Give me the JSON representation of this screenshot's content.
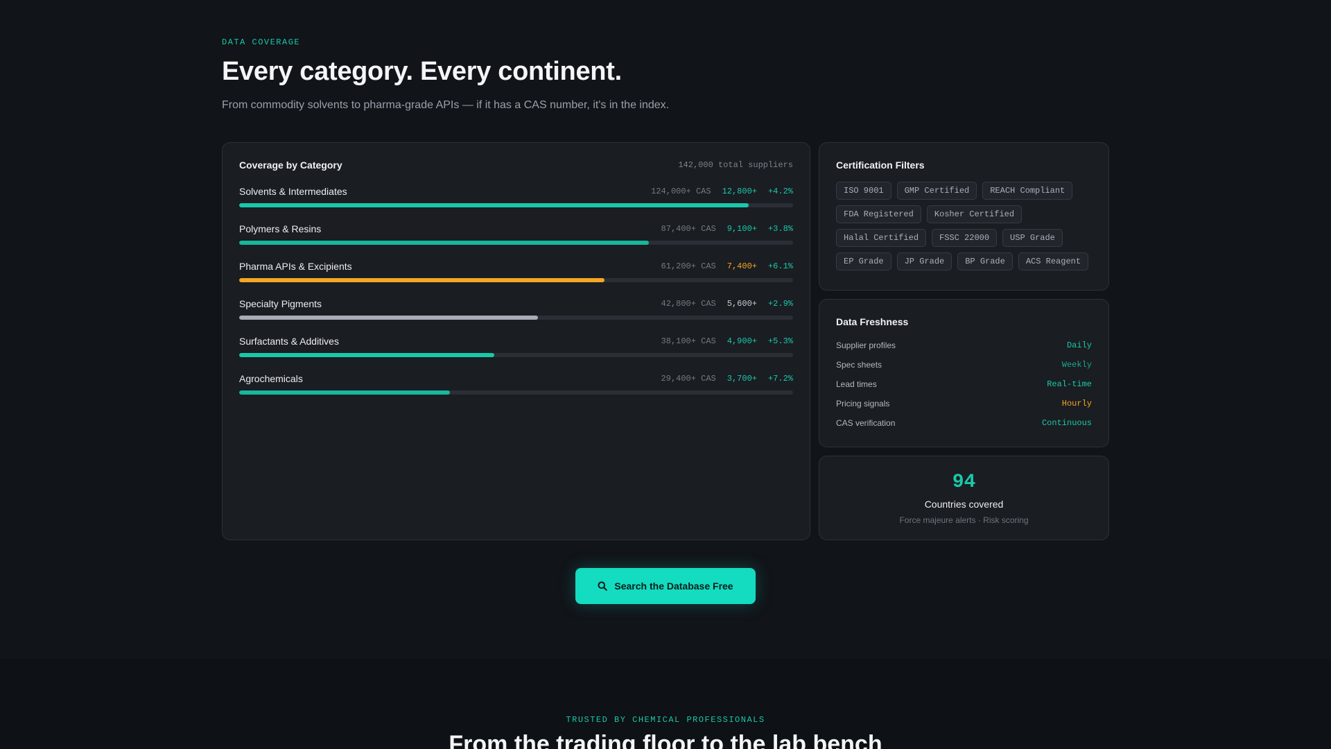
{
  "hero": {
    "eyebrow": "DATA COVERAGE",
    "title": "Every category. Every continent.",
    "subtitle": "From commodity solvents to pharma-grade APIs — if it has a CAS number, it's in the index."
  },
  "coverage": {
    "title": "Coverage by Category",
    "total": "142,000 total suppliers",
    "categories": [
      {
        "name": "Solvents & Intermediates",
        "cas": "124,000+ CAS",
        "count": "12,800+",
        "growth": "+4.2%",
        "fill": 0.92,
        "color": "#19c9aa",
        "count_color": "#19c9aa"
      },
      {
        "name": "Polymers & Resins",
        "cas": "87,400+ CAS",
        "count": "9,100+",
        "growth": "+3.8%",
        "fill": 0.74,
        "color": "#17b89c",
        "count_color": "#19c9aa"
      },
      {
        "name": "Pharma APIs & Excipients",
        "cas": "61,200+ CAS",
        "count": "7,400+",
        "growth": "+6.1%",
        "fill": 0.66,
        "color": "#f5a623",
        "count_color": "#f5a623"
      },
      {
        "name": "Specialty Pigments",
        "cas": "42,800+ CAS",
        "count": "5,600+",
        "growth": "+2.9%",
        "fill": 0.54,
        "color": "#a9acb6",
        "count_color": "#c9cdd3"
      },
      {
        "name": "Surfactants & Additives",
        "cas": "38,100+ CAS",
        "count": "4,900+",
        "growth": "+5.3%",
        "fill": 0.46,
        "color": "#19c9aa",
        "count_color": "#19c9aa"
      },
      {
        "name": "Agrochemicals",
        "cas": "29,400+ CAS",
        "count": "3,700+",
        "growth": "+7.2%",
        "fill": 0.38,
        "color": "#17b89c",
        "count_color": "#19c9aa"
      }
    ]
  },
  "certs": {
    "title": "Certification Filters",
    "tags": [
      "ISO 9001",
      "GMP Certified",
      "REACH Compliant",
      "FDA Registered",
      "Kosher Certified",
      "Halal Certified",
      "FSSC 22000",
      "USP Grade",
      "EP Grade",
      "JP Grade",
      "BP Grade",
      "ACS Reagent"
    ]
  },
  "freshness": {
    "title": "Data Freshness",
    "rows": [
      {
        "label": "Supplier profiles",
        "value": "Daily",
        "color": "#19c9aa"
      },
      {
        "label": "Spec sheets",
        "value": "Weekly",
        "color": "#17a88f"
      },
      {
        "label": "Lead times",
        "value": "Real-time",
        "color": "#19c9aa"
      },
      {
        "label": "Pricing signals",
        "value": "Hourly",
        "color": "#f5a623"
      },
      {
        "label": "CAS verification",
        "value": "Continuous",
        "color": "#19c9aa"
      }
    ]
  },
  "countries": {
    "number": "94",
    "label": "Countries covered",
    "sub": "Force majeure alerts · Risk scoring"
  },
  "cta": {
    "label": "Search the Database Free",
    "icon": "search-icon"
  },
  "lower": {
    "eyebrow": "TRUSTED BY CHEMICAL PROFESSIONALS",
    "title": "From the trading floor to the lab bench"
  }
}
